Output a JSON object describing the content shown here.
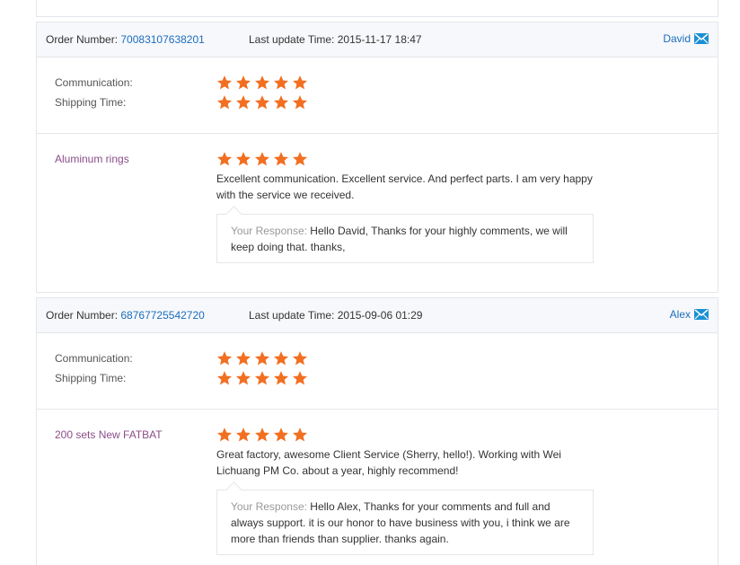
{
  "labels": {
    "order_number": "Order Number:",
    "last_update": "Last update Time:",
    "communication": "Communication:",
    "shipping_time": "Shipping Time:",
    "your_response": "Your Response:"
  },
  "colors": {
    "star": "#f26f21",
    "link": "#1b6dbd",
    "product": "#8a4d8a"
  },
  "feedbacks": [
    {
      "order_number": "70083107638201",
      "last_update": "2015-11-17 18:47",
      "buyer": "David",
      "communication_stars": 5,
      "shipping_stars": 5,
      "product_name": "Aluminum rings",
      "product_stars": 5,
      "comment": "Excellent communication. Excellent service. And perfect parts. I am very happy with the service we received.",
      "response": "Hello David, Thanks for your highly comments, we will keep doing that. thanks,"
    },
    {
      "order_number": "68767725542720",
      "last_update": "2015-09-06 01:29",
      "buyer": "Alex",
      "communication_stars": 5,
      "shipping_stars": 5,
      "product_name": "200 sets New FATBAT",
      "product_stars": 5,
      "comment": "Great factory, awesome Client Service (Sherry, hello!). Working with Wei Lichuang PM Co. about a year, highly recommend!",
      "response": "Hello Alex, Thanks for your comments and full and always support. it is our honor to have business with you, i think we are more than friends than supplier. thanks again."
    }
  ]
}
